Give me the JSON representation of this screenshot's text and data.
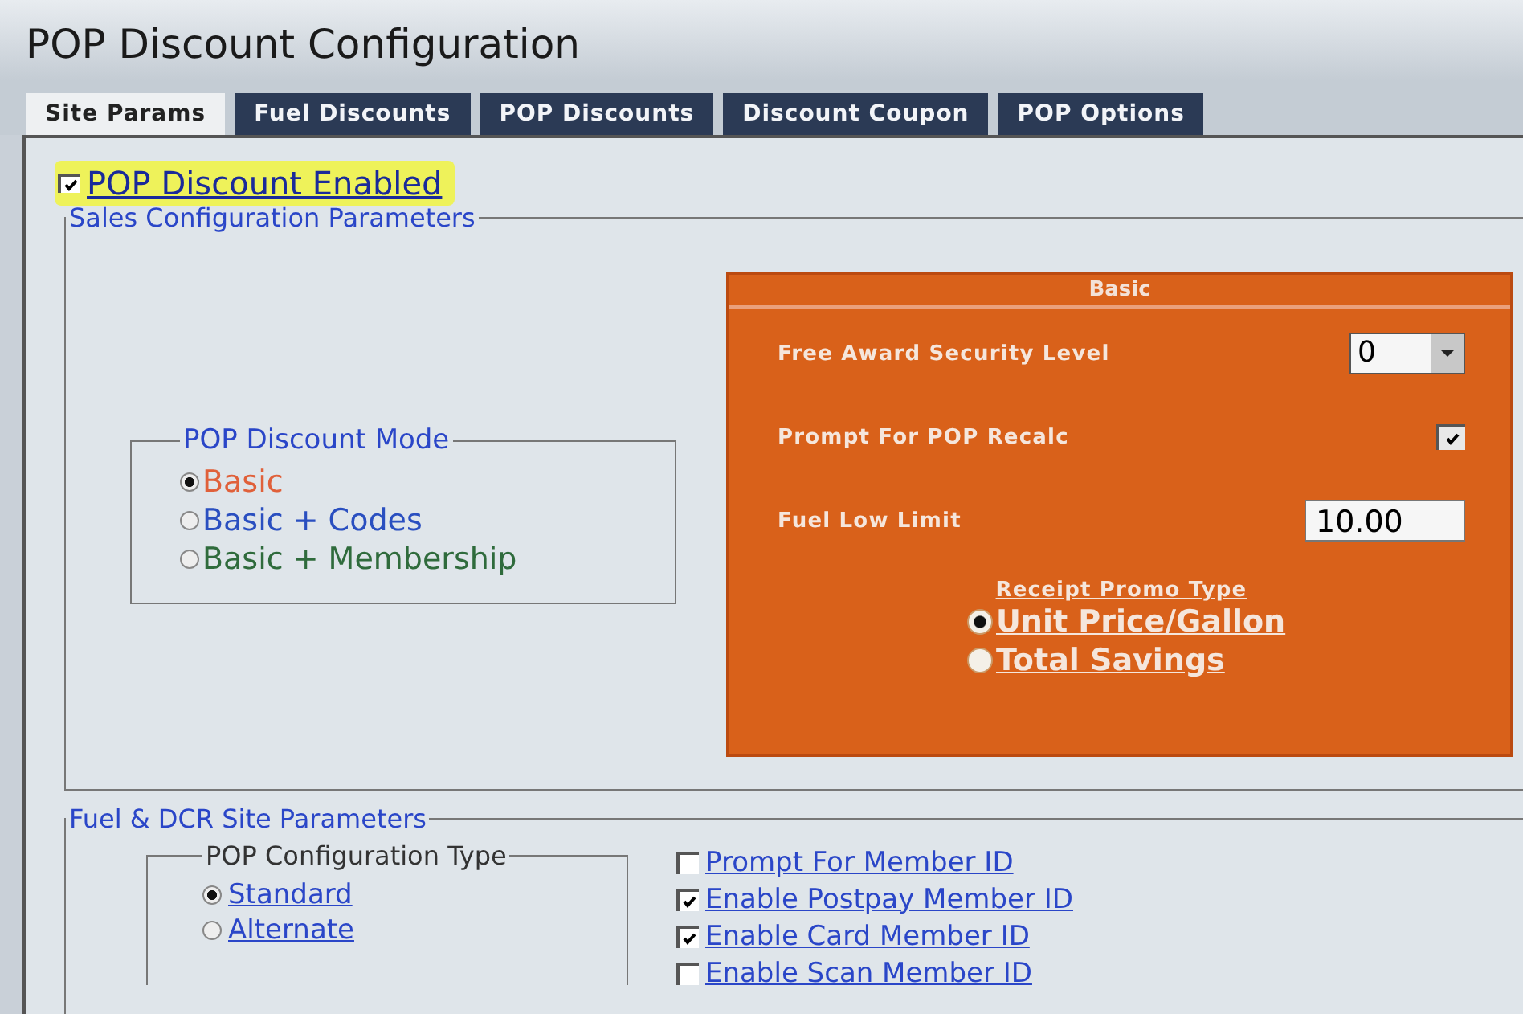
{
  "window": {
    "title": "POP Discount Configuration"
  },
  "tabs": [
    {
      "label": "Site Params",
      "selected": true
    },
    {
      "label": "Fuel Discounts",
      "selected": false
    },
    {
      "label": "POP Discounts",
      "selected": false
    },
    {
      "label": "Discount Coupon",
      "selected": false
    },
    {
      "label": "POP Options",
      "selected": false
    }
  ],
  "enabled": {
    "label": "POP Discount Enabled",
    "checked": true,
    "highlighted": true
  },
  "sales": {
    "legend": "Sales Configuration Parameters",
    "mode": {
      "legend": "POP Discount Mode",
      "options": [
        {
          "label": "Basic",
          "selected": true,
          "color": "#e0603a"
        },
        {
          "label": "Basic + Codes",
          "selected": false,
          "color": "#2a4fc0"
        },
        {
          "label": "Basic + Membership",
          "selected": false,
          "color": "#2f6b3c"
        }
      ]
    },
    "basic": {
      "title": "Basic",
      "rows": [
        {
          "kind": "dropdown",
          "label": "Free Award Security Level",
          "value": "0"
        },
        {
          "kind": "checkbox",
          "label": "Prompt For POP Recalc",
          "checked": true
        },
        {
          "kind": "input",
          "label": "Fuel Low Limit",
          "value": "10.00"
        }
      ],
      "promo": {
        "title": "Receipt Promo Type",
        "options": [
          {
            "label": "Unit Price/Gallon",
            "selected": true
          },
          {
            "label": "Total Savings",
            "selected": false
          }
        ]
      }
    }
  },
  "fuel": {
    "legend": "Fuel & DCR Site Parameters",
    "config": {
      "legend": "POP Configuration Type",
      "options": [
        {
          "label": "Standard",
          "selected": true
        },
        {
          "label": "Alternate",
          "selected": false
        }
      ]
    },
    "checks": [
      {
        "label": "Prompt For Member ID",
        "checked": false
      },
      {
        "label": "Enable Postpay Member ID",
        "checked": true
      },
      {
        "label": "Enable Card Member ID",
        "checked": true
      },
      {
        "label": "Enable Scan Member ID",
        "checked": false
      }
    ]
  }
}
